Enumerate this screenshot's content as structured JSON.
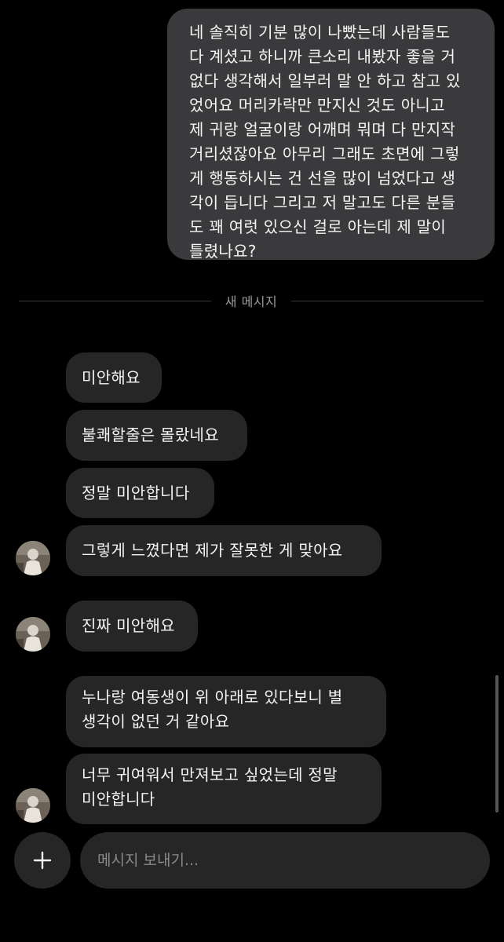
{
  "outgoing": {
    "text": "네 솔직히 기분 많이 나빴는데 사람들도\n다 계셨고 하니까 큰소리 내봤자 좋을 거\n없다 생각해서 일부러 말 안 하고 참고 있\n었어요 머리카락만 만지신 것도 아니고\n제 귀랑 얼굴이랑 어깨며 뭐며 다 만지작\n거리셨잖아요 아무리 그래도 초면에 그렇\n게 행동하시는 건 선을 많이 넘었다고 생\n각이 듭니다 그리고 저 말고도 다른 분들\n도 꽤 여럿 있으신 걸로 아는데 제 말이\n틀렸나요?"
  },
  "divider": {
    "label": "새 메시지"
  },
  "incoming": [
    {
      "text": "미안해요"
    },
    {
      "text": "불쾌할줄은 몰랐네요"
    },
    {
      "text": "정말 미안합니다"
    },
    {
      "text": "그렇게 느꼈다면 제가 잘못한 게 맞아요"
    },
    {
      "text": "진짜 미안해요"
    },
    {
      "text": "누나랑 여동생이 위 아래로 있다보니 별\n생각이 없던 거 같아요"
    },
    {
      "text": "너무 귀여워서 만져보고 싶었는데 정말\n미안합니다"
    }
  ],
  "composer": {
    "placeholder": "메시지 보내기...",
    "plus_icon": "plus-icon"
  },
  "colors": {
    "background": "#000000",
    "outgoing_bubble": "#3a3a3c",
    "incoming_bubble": "#262626",
    "text": "#f4f4f4",
    "divider_text": "#9a9a9a"
  }
}
